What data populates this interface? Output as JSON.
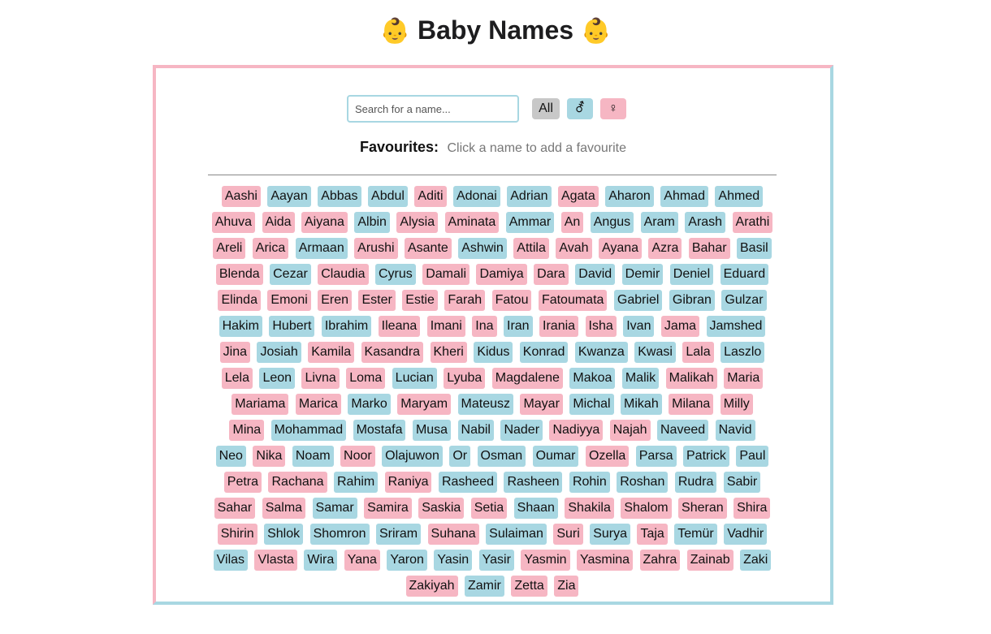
{
  "header": {
    "title": "Baby Names",
    "emoji": "👶"
  },
  "search": {
    "placeholder": "Search for a name..."
  },
  "filters": {
    "all": "All",
    "boy": "⚦",
    "girl": "♀"
  },
  "favourites": {
    "label": "Favourites:",
    "hint": "Click a name to add a favourite"
  },
  "colors": {
    "girl": "#f6b6c3",
    "boy": "#a8d7e2",
    "all": "#c8c8c8"
  },
  "names": [
    {
      "n": "Aashi",
      "g": "girl"
    },
    {
      "n": "Aayan",
      "g": "boy"
    },
    {
      "n": "Abbas",
      "g": "boy"
    },
    {
      "n": "Abdul",
      "g": "boy"
    },
    {
      "n": "Aditi",
      "g": "girl"
    },
    {
      "n": "Adonai",
      "g": "boy"
    },
    {
      "n": "Adrian",
      "g": "boy"
    },
    {
      "n": "Agata",
      "g": "girl"
    },
    {
      "n": "Aharon",
      "g": "boy"
    },
    {
      "n": "Ahmad",
      "g": "boy"
    },
    {
      "n": "Ahmed",
      "g": "boy"
    },
    {
      "n": "Ahuva",
      "g": "girl"
    },
    {
      "n": "Aida",
      "g": "girl"
    },
    {
      "n": "Aiyana",
      "g": "girl"
    },
    {
      "n": "Albin",
      "g": "boy"
    },
    {
      "n": "Alysia",
      "g": "girl"
    },
    {
      "n": "Aminata",
      "g": "girl"
    },
    {
      "n": "Ammar",
      "g": "boy"
    },
    {
      "n": "An",
      "g": "girl"
    },
    {
      "n": "Angus",
      "g": "boy"
    },
    {
      "n": "Aram",
      "g": "boy"
    },
    {
      "n": "Arash",
      "g": "boy"
    },
    {
      "n": "Arathi",
      "g": "girl"
    },
    {
      "n": "Areli",
      "g": "girl"
    },
    {
      "n": "Arica",
      "g": "girl"
    },
    {
      "n": "Armaan",
      "g": "boy"
    },
    {
      "n": "Arushi",
      "g": "girl"
    },
    {
      "n": "Asante",
      "g": "girl"
    },
    {
      "n": "Ashwin",
      "g": "boy"
    },
    {
      "n": "Attila",
      "g": "girl"
    },
    {
      "n": "Avah",
      "g": "girl"
    },
    {
      "n": "Ayana",
      "g": "girl"
    },
    {
      "n": "Azra",
      "g": "girl"
    },
    {
      "n": "Bahar",
      "g": "girl"
    },
    {
      "n": "Basil",
      "g": "boy"
    },
    {
      "n": "Blenda",
      "g": "girl"
    },
    {
      "n": "Cezar",
      "g": "boy"
    },
    {
      "n": "Claudia",
      "g": "girl"
    },
    {
      "n": "Cyrus",
      "g": "boy"
    },
    {
      "n": "Damali",
      "g": "girl"
    },
    {
      "n": "Damiya",
      "g": "girl"
    },
    {
      "n": "Dara",
      "g": "girl"
    },
    {
      "n": "David",
      "g": "boy"
    },
    {
      "n": "Demir",
      "g": "boy"
    },
    {
      "n": "Deniel",
      "g": "boy"
    },
    {
      "n": "Eduard",
      "g": "boy"
    },
    {
      "n": "Elinda",
      "g": "girl"
    },
    {
      "n": "Emoni",
      "g": "girl"
    },
    {
      "n": "Eren",
      "g": "girl"
    },
    {
      "n": "Ester",
      "g": "girl"
    },
    {
      "n": "Estie",
      "g": "girl"
    },
    {
      "n": "Farah",
      "g": "girl"
    },
    {
      "n": "Fatou",
      "g": "girl"
    },
    {
      "n": "Fatoumata",
      "g": "girl"
    },
    {
      "n": "Gabriel",
      "g": "boy"
    },
    {
      "n": "Gibran",
      "g": "boy"
    },
    {
      "n": "Gulzar",
      "g": "boy"
    },
    {
      "n": "Hakim",
      "g": "boy"
    },
    {
      "n": "Hubert",
      "g": "boy"
    },
    {
      "n": "Ibrahim",
      "g": "boy"
    },
    {
      "n": "Ileana",
      "g": "girl"
    },
    {
      "n": "Imani",
      "g": "girl"
    },
    {
      "n": "Ina",
      "g": "girl"
    },
    {
      "n": "Iran",
      "g": "boy"
    },
    {
      "n": "Irania",
      "g": "girl"
    },
    {
      "n": "Isha",
      "g": "girl"
    },
    {
      "n": "Ivan",
      "g": "boy"
    },
    {
      "n": "Jama",
      "g": "girl"
    },
    {
      "n": "Jamshed",
      "g": "boy"
    },
    {
      "n": "Jina",
      "g": "girl"
    },
    {
      "n": "Josiah",
      "g": "boy"
    },
    {
      "n": "Kamila",
      "g": "girl"
    },
    {
      "n": "Kasandra",
      "g": "girl"
    },
    {
      "n": "Kheri",
      "g": "girl"
    },
    {
      "n": "Kidus",
      "g": "boy"
    },
    {
      "n": "Konrad",
      "g": "boy"
    },
    {
      "n": "Kwanza",
      "g": "boy"
    },
    {
      "n": "Kwasi",
      "g": "boy"
    },
    {
      "n": "Lala",
      "g": "girl"
    },
    {
      "n": "Laszlo",
      "g": "boy"
    },
    {
      "n": "Lela",
      "g": "girl"
    },
    {
      "n": "Leon",
      "g": "boy"
    },
    {
      "n": "Livna",
      "g": "girl"
    },
    {
      "n": "Loma",
      "g": "girl"
    },
    {
      "n": "Lucian",
      "g": "boy"
    },
    {
      "n": "Lyuba",
      "g": "girl"
    },
    {
      "n": "Magdalene",
      "g": "girl"
    },
    {
      "n": "Makoa",
      "g": "boy"
    },
    {
      "n": "Malik",
      "g": "boy"
    },
    {
      "n": "Malikah",
      "g": "girl"
    },
    {
      "n": "Maria",
      "g": "girl"
    },
    {
      "n": "Mariama",
      "g": "girl"
    },
    {
      "n": "Marica",
      "g": "girl"
    },
    {
      "n": "Marko",
      "g": "boy"
    },
    {
      "n": "Maryam",
      "g": "girl"
    },
    {
      "n": "Mateusz",
      "g": "boy"
    },
    {
      "n": "Mayar",
      "g": "girl"
    },
    {
      "n": "Michal",
      "g": "boy"
    },
    {
      "n": "Mikah",
      "g": "boy"
    },
    {
      "n": "Milana",
      "g": "girl"
    },
    {
      "n": "Milly",
      "g": "girl"
    },
    {
      "n": "Mina",
      "g": "girl"
    },
    {
      "n": "Mohammad",
      "g": "boy"
    },
    {
      "n": "Mostafa",
      "g": "boy"
    },
    {
      "n": "Musa",
      "g": "boy"
    },
    {
      "n": "Nabil",
      "g": "boy"
    },
    {
      "n": "Nader",
      "g": "boy"
    },
    {
      "n": "Nadiyya",
      "g": "girl"
    },
    {
      "n": "Najah",
      "g": "girl"
    },
    {
      "n": "Naveed",
      "g": "boy"
    },
    {
      "n": "Navid",
      "g": "boy"
    },
    {
      "n": "Neo",
      "g": "boy"
    },
    {
      "n": "Nika",
      "g": "girl"
    },
    {
      "n": "Noam",
      "g": "boy"
    },
    {
      "n": "Noor",
      "g": "girl"
    },
    {
      "n": "Olajuwon",
      "g": "boy"
    },
    {
      "n": "Or",
      "g": "boy"
    },
    {
      "n": "Osman",
      "g": "boy"
    },
    {
      "n": "Oumar",
      "g": "boy"
    },
    {
      "n": "Ozella",
      "g": "girl"
    },
    {
      "n": "Parsa",
      "g": "boy"
    },
    {
      "n": "Patrick",
      "g": "boy"
    },
    {
      "n": "Paul",
      "g": "boy"
    },
    {
      "n": "Petra",
      "g": "girl"
    },
    {
      "n": "Rachana",
      "g": "girl"
    },
    {
      "n": "Rahim",
      "g": "boy"
    },
    {
      "n": "Raniya",
      "g": "girl"
    },
    {
      "n": "Rasheed",
      "g": "boy"
    },
    {
      "n": "Rasheen",
      "g": "boy"
    },
    {
      "n": "Rohin",
      "g": "boy"
    },
    {
      "n": "Roshan",
      "g": "boy"
    },
    {
      "n": "Rudra",
      "g": "boy"
    },
    {
      "n": "Sabir",
      "g": "boy"
    },
    {
      "n": "Sahar",
      "g": "girl"
    },
    {
      "n": "Salma",
      "g": "girl"
    },
    {
      "n": "Samar",
      "g": "boy"
    },
    {
      "n": "Samira",
      "g": "girl"
    },
    {
      "n": "Saskia",
      "g": "girl"
    },
    {
      "n": "Setia",
      "g": "girl"
    },
    {
      "n": "Shaan",
      "g": "boy"
    },
    {
      "n": "Shakila",
      "g": "girl"
    },
    {
      "n": "Shalom",
      "g": "girl"
    },
    {
      "n": "Sheran",
      "g": "girl"
    },
    {
      "n": "Shira",
      "g": "girl"
    },
    {
      "n": "Shirin",
      "g": "girl"
    },
    {
      "n": "Shlok",
      "g": "boy"
    },
    {
      "n": "Shomron",
      "g": "boy"
    },
    {
      "n": "Sriram",
      "g": "boy"
    },
    {
      "n": "Suhana",
      "g": "girl"
    },
    {
      "n": "Sulaiman",
      "g": "boy"
    },
    {
      "n": "Suri",
      "g": "girl"
    },
    {
      "n": "Surya",
      "g": "boy"
    },
    {
      "n": "Taja",
      "g": "girl"
    },
    {
      "n": "Temür",
      "g": "boy"
    },
    {
      "n": "Vadhir",
      "g": "boy"
    },
    {
      "n": "Vilas",
      "g": "boy"
    },
    {
      "n": "Vlasta",
      "g": "girl"
    },
    {
      "n": "Wira",
      "g": "boy"
    },
    {
      "n": "Yana",
      "g": "girl"
    },
    {
      "n": "Yaron",
      "g": "boy"
    },
    {
      "n": "Yasin",
      "g": "boy"
    },
    {
      "n": "Yasir",
      "g": "boy"
    },
    {
      "n": "Yasmin",
      "g": "girl"
    },
    {
      "n": "Yasmina",
      "g": "girl"
    },
    {
      "n": "Zahra",
      "g": "girl"
    },
    {
      "n": "Zainab",
      "g": "girl"
    },
    {
      "n": "Zaki",
      "g": "boy"
    },
    {
      "n": "Zakiyah",
      "g": "girl"
    },
    {
      "n": "Zamir",
      "g": "boy"
    },
    {
      "n": "Zetta",
      "g": "girl"
    },
    {
      "n": "Zia",
      "g": "girl"
    }
  ]
}
